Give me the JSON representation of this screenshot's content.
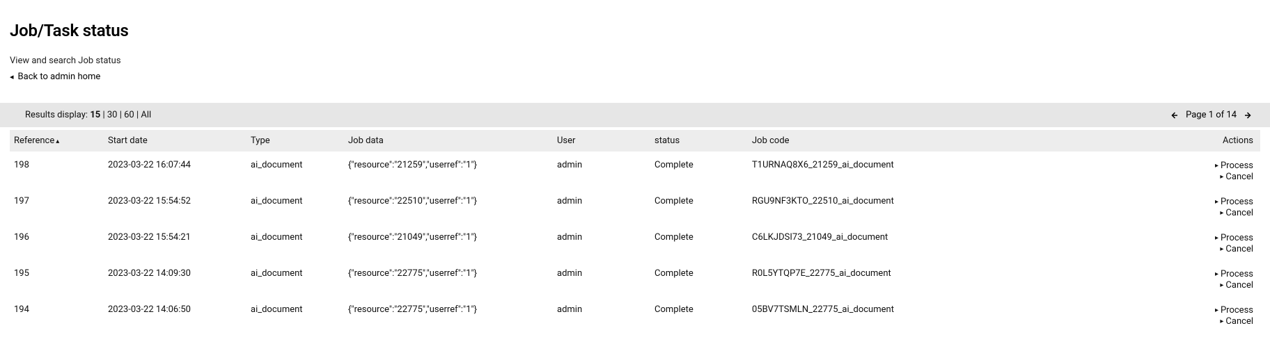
{
  "header": {
    "title": "Job/Task status",
    "subtitle": "View and search Job status",
    "back_label": "Back to admin home"
  },
  "toolbar": {
    "results_label": "Results display:",
    "options": [
      "15",
      "30",
      "60",
      "All"
    ],
    "active_option": "15",
    "page_label": "Page 1 of 14"
  },
  "columns": {
    "reference": "Reference",
    "start_date": "Start date",
    "type": "Type",
    "job_data": "Job data",
    "user": "User",
    "status": "status",
    "job_code": "Job code",
    "actions": "Actions"
  },
  "actions": {
    "process": "Process",
    "cancel": "Cancel"
  },
  "rows": [
    {
      "reference": "198",
      "start_date": "2023-03-22 16:07:44",
      "type": "ai_document",
      "job_data": "{\"resource\":\"21259\",\"userref\":\"1\"}",
      "user": "admin",
      "status": "Complete",
      "job_code": "T1URNAQ8X6_21259_ai_document"
    },
    {
      "reference": "197",
      "start_date": "2023-03-22 15:54:52",
      "type": "ai_document",
      "job_data": "{\"resource\":\"22510\",\"userref\":\"1\"}",
      "user": "admin",
      "status": "Complete",
      "job_code": "RGU9NF3KTO_22510_ai_document"
    },
    {
      "reference": "196",
      "start_date": "2023-03-22 15:54:21",
      "type": "ai_document",
      "job_data": "{\"resource\":\"21049\",\"userref\":\"1\"}",
      "user": "admin",
      "status": "Complete",
      "job_code": "C6LKJDSI73_21049_ai_document"
    },
    {
      "reference": "195",
      "start_date": "2023-03-22 14:09:30",
      "type": "ai_document",
      "job_data": "{\"resource\":\"22775\",\"userref\":\"1\"}",
      "user": "admin",
      "status": "Complete",
      "job_code": "R0L5YTQP7E_22775_ai_document"
    },
    {
      "reference": "194",
      "start_date": "2023-03-22 14:06:50",
      "type": "ai_document",
      "job_data": "{\"resource\":\"22775\",\"userref\":\"1\"}",
      "user": "admin",
      "status": "Complete",
      "job_code": "05BV7TSMLN_22775_ai_document"
    }
  ]
}
